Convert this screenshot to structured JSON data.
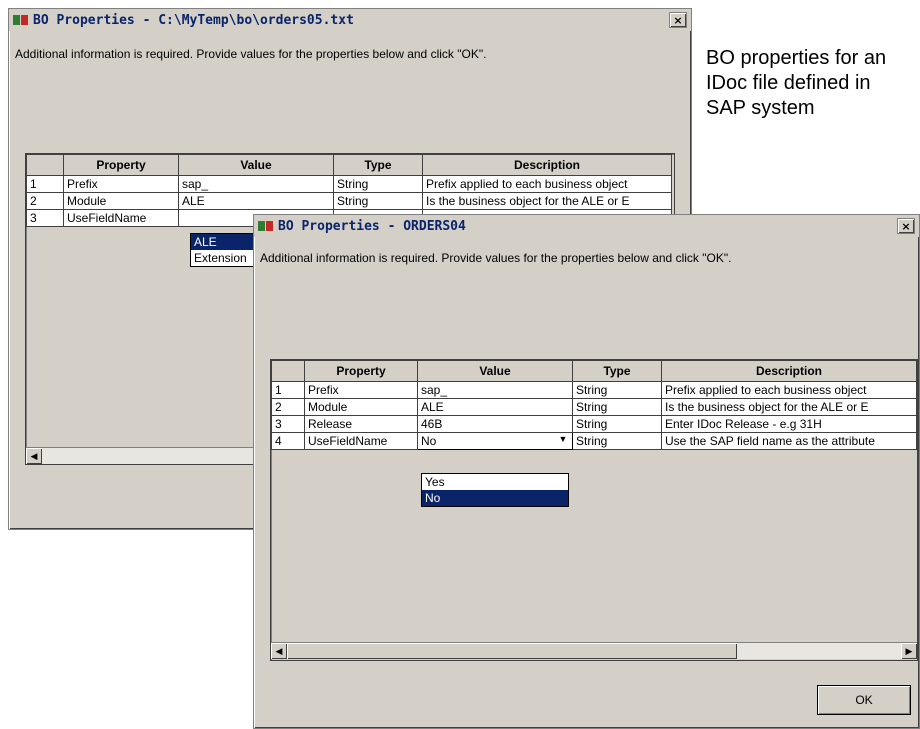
{
  "caption": "BO properties for an IDoc file defined in SAP system",
  "dialog1": {
    "title": "BO Properties - C:\\MyTemp\\bo\\orders05.txt",
    "close": "×",
    "info": "Additional information is required. Provide values for the properties below and click \"OK\".",
    "headers": [
      "",
      "Property",
      "Value",
      "Type",
      "Description"
    ],
    "rows": [
      {
        "num": "1",
        "property": "Prefix",
        "value": "sap_",
        "type": "String",
        "description": "Prefix applied to each business object"
      },
      {
        "num": "2",
        "property": "Module",
        "value": "ALE",
        "type": "String",
        "description": "Is the business object for the ALE or E"
      },
      {
        "num": "3",
        "property": "UseFieldName",
        "value": "",
        "type": "",
        "description": ""
      }
    ],
    "dropdown": {
      "options": [
        "ALE",
        "Extension"
      ],
      "selected": "ALE"
    }
  },
  "dialog2": {
    "title": "BO Properties - ORDERS04",
    "close": "×",
    "info": "Additional information is required. Provide values for the properties below and click \"OK\".",
    "headers": [
      "",
      "Property",
      "Value",
      "Type",
      "Description"
    ],
    "rows": [
      {
        "num": "1",
        "property": "Prefix",
        "value": "sap_",
        "type": "String",
        "description": "Prefix applied to each business object"
      },
      {
        "num": "2",
        "property": "Module",
        "value": "ALE",
        "type": "String",
        "description": "Is the business object for the ALE or E"
      },
      {
        "num": "3",
        "property": "Release",
        "value": "46B",
        "type": "String",
        "description": "Enter IDoc Release - e.g 31H"
      },
      {
        "num": "4",
        "property": "UseFieldName",
        "value": "No",
        "type": "String",
        "description": "Use the SAP field name as the attribute"
      }
    ],
    "dropdown": {
      "options": [
        "Yes",
        "No"
      ],
      "selected": "No"
    },
    "ok_label": "OK"
  }
}
